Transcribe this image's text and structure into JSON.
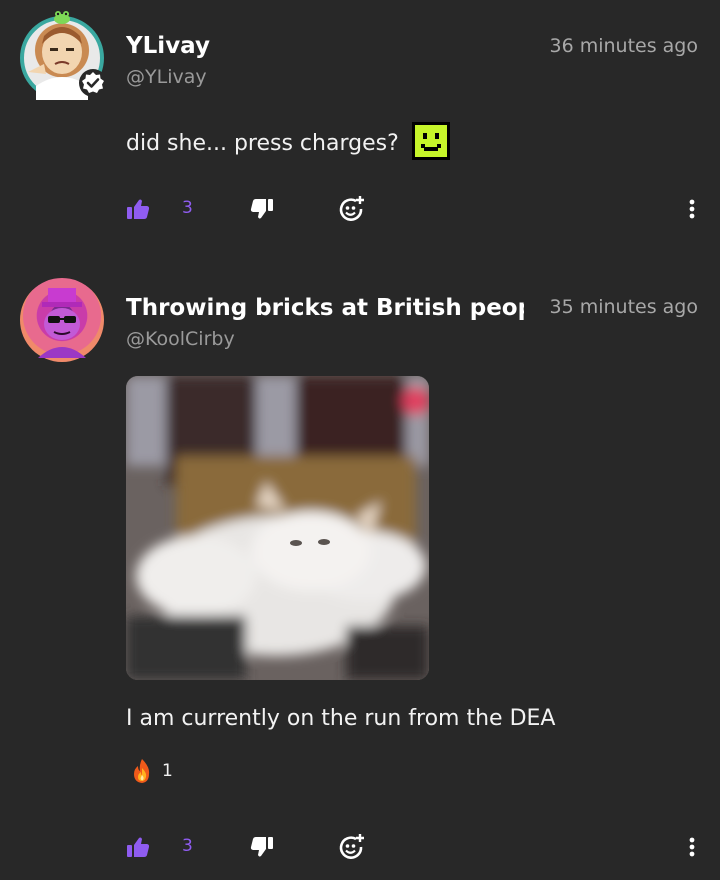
{
  "posts": [
    {
      "username": "YLivay",
      "handle": "@YLivay",
      "timestamp": "36 minutes ago",
      "text": "did she... press charges?",
      "likes": "3"
    },
    {
      "username": "Throwing bricks at British peop",
      "handle": "@KoolCirby",
      "timestamp": "35 minutes ago",
      "text": "I am currently on the run from the DEA",
      "reaction_count": "1",
      "likes": "3"
    }
  ],
  "colors": {
    "background": "#282828",
    "accent_like": "#8f5cf0",
    "emote_green": "#c6f52a"
  },
  "icons": [
    "thumbs-up-icon",
    "thumbs-down-icon",
    "add-reaction-icon",
    "more-vertical-icon",
    "verified-icon",
    "fire-icon",
    "pixel-smiley-emote"
  ]
}
